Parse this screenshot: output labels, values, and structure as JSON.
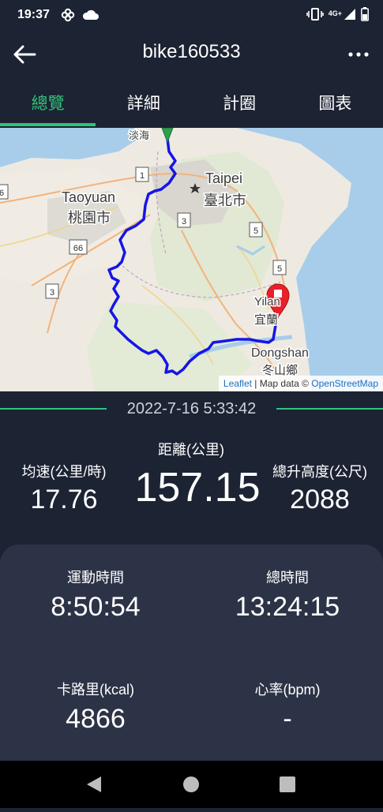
{
  "status": {
    "time": "19:37",
    "network": "4G+"
  },
  "app_bar": {
    "title": "bike160533"
  },
  "tabs": [
    {
      "label": "總覽",
      "active": true
    },
    {
      "label": "詳細",
      "active": false
    },
    {
      "label": "計圈",
      "active": false
    },
    {
      "label": "圖表",
      "active": false
    }
  ],
  "map": {
    "labels": {
      "tamsui": "淡海",
      "taipei_en": "Taipei",
      "taipei_zh": "臺北市",
      "taoyuan_en": "Taoyuan",
      "taoyuan_zh": "桃園市",
      "yilan_en": "Yilan",
      "yilan_zh": "宜蘭",
      "dongshan_en": "Dongshan",
      "dongshan_zh": "冬山鄉",
      "shield_1": "1",
      "shield_3a": "3",
      "shield_3b": "3",
      "shield_5a": "5",
      "shield_5b": "5",
      "shield_6": "6",
      "shield_66": "66"
    },
    "attribution": {
      "leaflet": "Leaflet",
      "sep": " | Map data © ",
      "osm": "OpenStreetMap"
    },
    "route_color": "#1515e6",
    "start_marker_color": "#2e9e4f",
    "end_marker_color": "#e8202a"
  },
  "summary": {
    "datetime": "2022-7-16 5:33:42",
    "distance_label": "距離(公里)",
    "distance_value": "157.15",
    "avg_speed_label": "均速(公里/時)",
    "avg_speed_value": "17.76",
    "elevation_label": "總升高度(公尺)",
    "elevation_value": "2088"
  },
  "details": {
    "moving_time_label": "運動時間",
    "moving_time_value": "8:50:54",
    "total_time_label": "總時間",
    "total_time_value": "13:24:15",
    "calories_label": "卡路里(kcal)",
    "calories_value": "4866",
    "heart_rate_label": "心率(bpm)",
    "heart_rate_value": "-"
  },
  "colors": {
    "background": "#1c2333",
    "card": "#2c3346",
    "accent": "#31c27a"
  }
}
